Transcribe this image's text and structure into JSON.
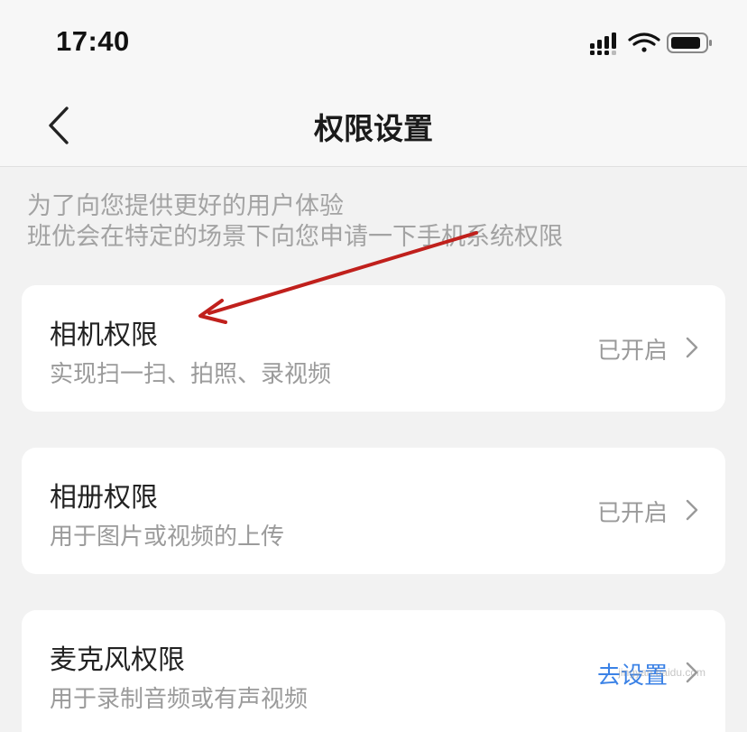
{
  "status_bar": {
    "time": "17:40",
    "icons": [
      "signal-icon",
      "wifi-icon",
      "battery-icon"
    ]
  },
  "nav": {
    "title": "权限设置",
    "back_icon": "chevron-left-icon"
  },
  "intro": {
    "line1": "为了向您提供更好的用户体验",
    "line2": "班优会在特定的场景下向您申请一下手机系统权限"
  },
  "permissions": [
    {
      "title": "相机权限",
      "desc": "实现扫一扫、拍照、录视频",
      "status": "已开启"
    },
    {
      "title": "相册权限",
      "desc": "用于图片或视频的上传",
      "status": "已开启"
    },
    {
      "title": "麦克风权限",
      "desc": "用于录制音频或有声视频",
      "status": "去设置"
    }
  ],
  "watermark": {
    "url": "jingyan.baidu.com"
  },
  "colors": {
    "background": "#f2f2f2",
    "card": "#ffffff",
    "action": "#3b82e6",
    "annotation_arrow": "#c0201c"
  }
}
